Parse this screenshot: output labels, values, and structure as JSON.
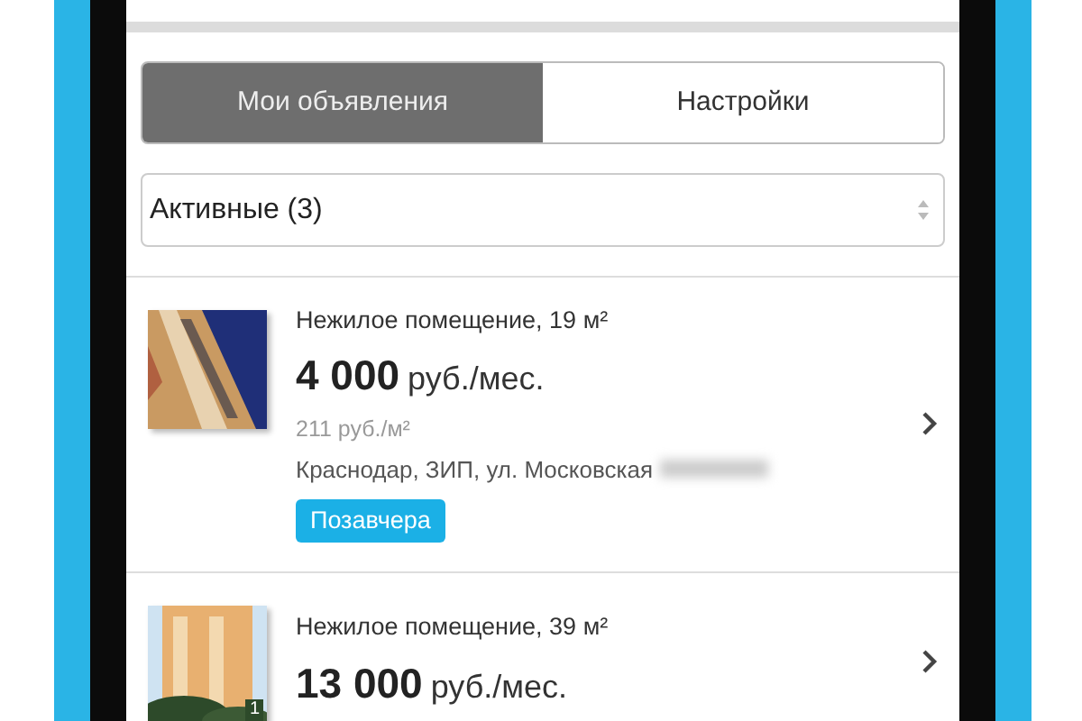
{
  "tabs": [
    {
      "label": "Мои объявления",
      "selected": true
    },
    {
      "label": "Настройки",
      "selected": false
    }
  ],
  "filter": {
    "value": "Активные (3)"
  },
  "listings": [
    {
      "title": "Нежилое помещение, 19 м²",
      "price": "4 000",
      "price_unit": "руб./мес.",
      "price_per_m2": "211 руб./м²",
      "address": "Краснодар, ЗИП, ул. Московская",
      "address_blurred": true,
      "date": "Позавчера"
    },
    {
      "title": "Нежилое помещение, 39 м²",
      "price": "13 000",
      "price_unit": "руб./мес.",
      "photo_count": "1"
    }
  ]
}
